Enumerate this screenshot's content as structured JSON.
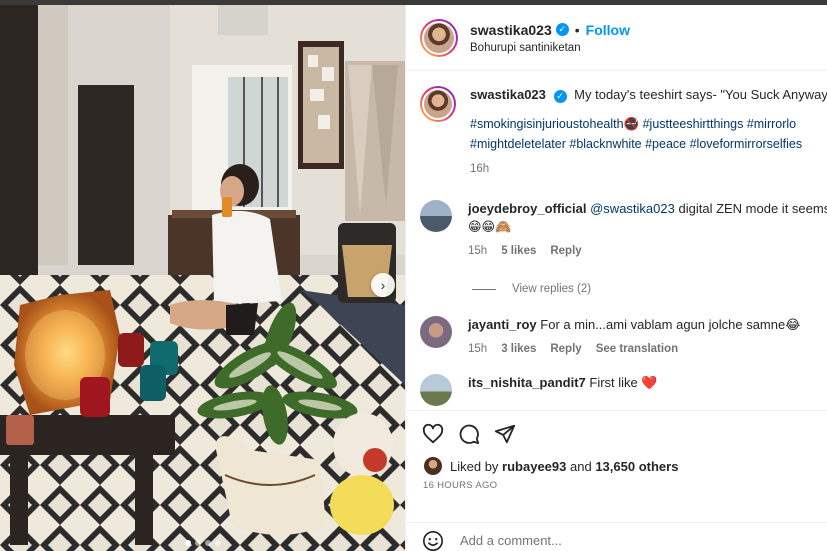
{
  "header": {
    "username": "swastika023",
    "follow_label": "Follow",
    "separator": "•",
    "location": "Bohurupi santiniketan"
  },
  "caption": {
    "username": "swastika023",
    "text": "My today's teeshirt says- \"You Suck Anyway\"",
    "hashtags": "#smokingisinjurioustohealth🚭 #justteeshirtthings #mirrorlo #mightdeletelater #blacknwhite #peace #loveformirrorselfies",
    "time": "16h"
  },
  "comments": [
    {
      "username": "joeydebroy_official",
      "mention": "@swastika023",
      "text": "digital ZEN mode it seems",
      "emoji": "😁😁🙈",
      "time": "15h",
      "likes": "5 likes",
      "reply_label": "Reply"
    },
    {
      "username": "jayanti_roy",
      "text": "For a min...ami vablam agun jolche samne😂",
      "time": "15h",
      "likes": "3 likes",
      "reply_label": "Reply",
      "translate_label": "See translation"
    },
    {
      "username": "its_nishita_pandit7",
      "text": "First like",
      "emoji": "❤️"
    }
  ],
  "view_replies": "View replies (2)",
  "likes": {
    "prefix": "Liked by",
    "user": "rubayee93",
    "joiner": "and",
    "others": "13,650 others"
  },
  "time_ago": "16 HOURS AGO",
  "add_comment_placeholder": "Add a comment...",
  "icons": [
    "heart-icon",
    "comment-icon",
    "share-icon",
    "emoji-icon",
    "next-arrow-icon"
  ],
  "colors": {
    "link_blue": "#0095f6",
    "hashtag_blue": "#00376b",
    "muted": "#737373"
  },
  "carousel": {
    "dots": 4,
    "active": 0
  }
}
